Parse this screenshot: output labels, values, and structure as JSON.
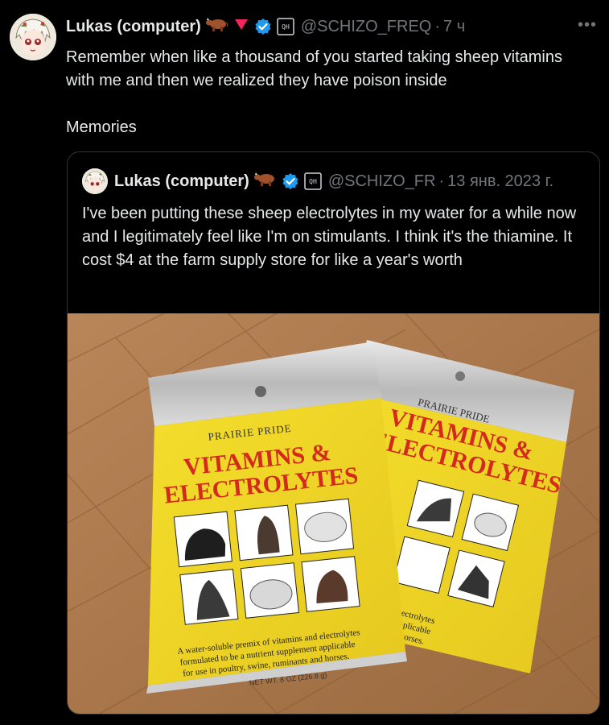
{
  "tweet": {
    "author_name": "Lukas (computer)",
    "handle": "@SCHIZO_FREQ",
    "time": "7 ч",
    "more_label": "•••",
    "text": "Remember when like a thousand of you started taking sheep vitamins with me and then we realized they have poison inside\n\nMemories",
    "icons": [
      "cow-emoji-icon",
      "red-triangle-icon",
      "verified-badge-icon",
      "affiliate-badge-icon"
    ]
  },
  "quote": {
    "author_name": "Lukas (computer)",
    "handle": "@SCHIZO_FR",
    "date": "13 янв. 2023 г.",
    "text": "I've been putting these sheep electrolytes in my water for a while now and I legitimately feel like I'm on stimulants. I think it's the thiamine. It cost $4 at the farm supply store for like a year's worth"
  },
  "photo": {
    "brand": "PRAIRIE PRIDE",
    "title_line1": "VITAMINS &",
    "title_line2": "ELECTROLYTES",
    "desc_line1": "A water-soluble premix of vitamins and electrolytes",
    "desc_line2": "formulated to be a nutrient supplement applicable",
    "desc_line3": "for use in poultry, swine, ruminants and horses.",
    "net_wt": "NET WT. 8 OZ (226.8 g)",
    "back_desc_line1": "ns and electrolytes",
    "back_desc_line2": "ement applicable",
    "back_desc_line3": "nts and horses."
  },
  "colors": {
    "background": "#000000",
    "text": "#e7e9ea",
    "muted": "#71767b",
    "verified": "#1d9bf0",
    "border": "#2f3336",
    "package_yellow": "#f0d92a",
    "package_red": "#d42a1c"
  }
}
